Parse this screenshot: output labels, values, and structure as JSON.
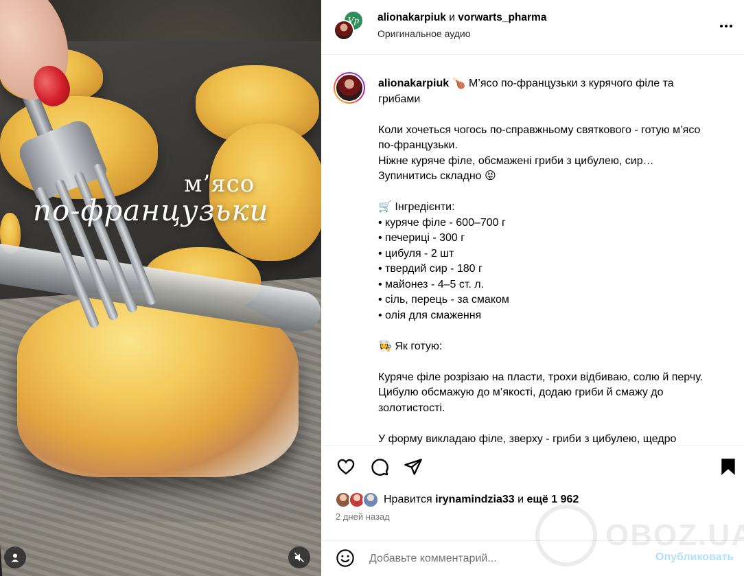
{
  "media": {
    "overlay_line1": "м’ясо",
    "overlay_line2": "по-французьки",
    "icons": [
      "user-tag-icon",
      "mute-icon"
    ]
  },
  "header": {
    "author1": "alionakarpiuk",
    "conjunction": "и",
    "author2": "vorwarts_pharma",
    "audio": "Оригинальное аудио",
    "brand_initials": "Vp"
  },
  "caption": {
    "username": "alionakarpiuk",
    "text": " 🍗 М’ясо по-французьки з курячого філе та грибами\n\nКоли хочеться чогось по-справжньому святкового - готую м’ясо по-французьки.\nНіжне куряче філе, обсмажені гриби з цибулею, сир…\nЗупинитись складно 😝\n\n🛒 Інгредієнти:\n• куряче філе - 600–700 г\n• печериці - 300 г\n• цибуля - 2 шт\n• твердий сир - 180 г\n• майонез - 4–5 ст. л.\n• сіль, перець - за смаком\n• олія для смаження\n\n👩‍🍳 Як готую:\n\nКуряче філе розрізаю на пласти, трохи відбиваю, солю й перчу.\nЦибулю обсмажую до м’якості, додаю гриби й смажу до золотистості.\n\nУ форму викладаю філе, зверху - гриби з цибулею, щедро"
  },
  "likes": {
    "prefix": "Нравится",
    "user": "irynamindzia33",
    "middle": "и",
    "count": "ещё 1 962"
  },
  "date": "2 дней назад",
  "comment": {
    "placeholder": "Добавьте комментарий...",
    "post_label": "Опубликовать"
  },
  "watermark": "OBOZ.UA",
  "colors": {
    "post_disabled": "#b2dffc",
    "secondary_text": "#737373",
    "divider": "#efefef"
  }
}
